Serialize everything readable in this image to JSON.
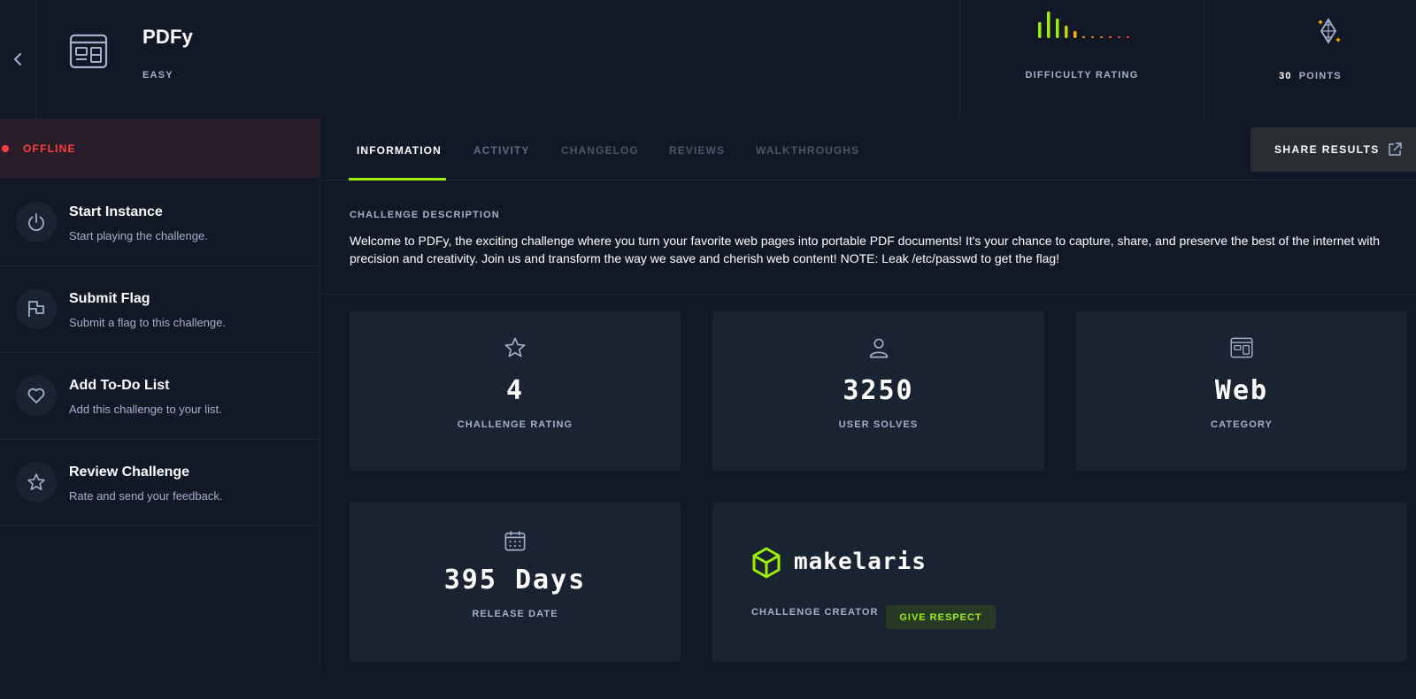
{
  "header": {
    "title": "PDFy",
    "difficulty": "EASY",
    "difficulty_label": "DIFFICULTY RATING",
    "difficulty_bars_colors": [
      "#9fef00",
      "#9fef00",
      "#9fef00",
      "#c5d500",
      "#ffaf00",
      "#ffaf00",
      "#ff8800",
      "#ff8800",
      "#ff6a00",
      "#ff3e3e",
      "#ff3e3e"
    ],
    "points_value": "30",
    "points_label": "POINTS"
  },
  "sidebar": {
    "status": "OFFLINE",
    "items": [
      {
        "title": "Start Instance",
        "subtitle": "Start playing the challenge.",
        "icon": "power-icon"
      },
      {
        "title": "Submit Flag",
        "subtitle": "Submit a flag to this challenge.",
        "icon": "flag-icon"
      },
      {
        "title": "Add To-Do List",
        "subtitle": "Add this challenge to your list.",
        "icon": "heart-icon"
      },
      {
        "title": "Review Challenge",
        "subtitle": "Rate and send your feedback.",
        "icon": "star-icon"
      }
    ]
  },
  "tabs": {
    "items": [
      "INFORMATION",
      "ACTIVITY",
      "CHANGELOG",
      "REVIEWS",
      "WALKTHROUGHS"
    ],
    "active": "INFORMATION",
    "share_label": "SHARE RESULTS"
  },
  "description": {
    "heading": "CHALLENGE DESCRIPTION",
    "text": "Welcome to PDFy, the exciting challenge where you turn your favorite web pages into portable PDF documents! It's your chance to capture, share, and preserve the best of the internet with precision and creativity. Join us and transform the way we save and cherish web content! NOTE: Leak /etc/passwd to get the flag!"
  },
  "stats": {
    "rating": {
      "value": "4",
      "label": "CHALLENGE RATING",
      "icon": "star-icon"
    },
    "solves": {
      "value": "3250",
      "label": "USER SOLVES",
      "icon": "user-icon"
    },
    "category": {
      "value": "Web",
      "label": "CATEGORY",
      "icon": "web-icon"
    },
    "release": {
      "value": "395 Days",
      "label": "RELEASE DATE",
      "icon": "calendar-icon"
    }
  },
  "creator": {
    "name": "makelaris",
    "label": "CHALLENGE CREATOR",
    "respect_label": "GIVE RESPECT",
    "icon": "cube-icon"
  },
  "colors": {
    "background": "#111927",
    "card": "#1a2332",
    "accent": "#9fef00",
    "offline": "#ff3e3e",
    "muted": "#a4b1cd"
  }
}
